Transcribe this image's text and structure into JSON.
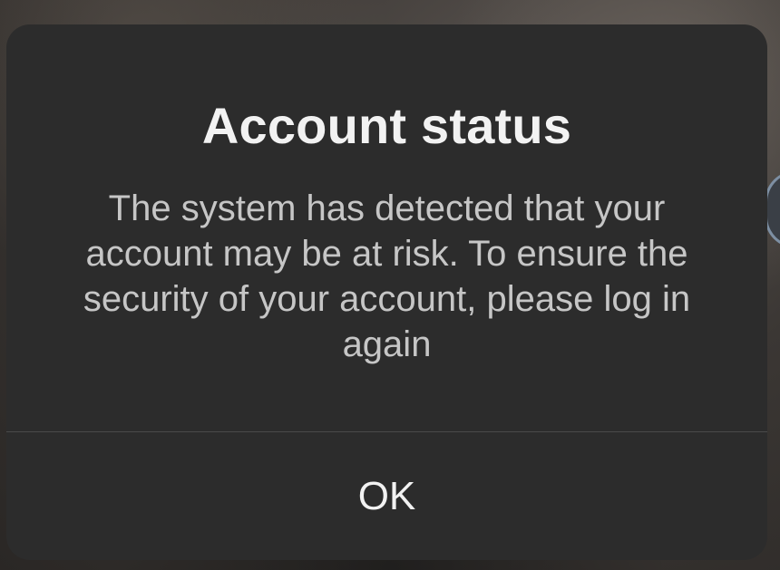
{
  "dialog": {
    "title": "Account status",
    "message": "The system has detected that your account may be at risk. To ensure the security of your account, please log in again",
    "ok_label": "OK"
  }
}
